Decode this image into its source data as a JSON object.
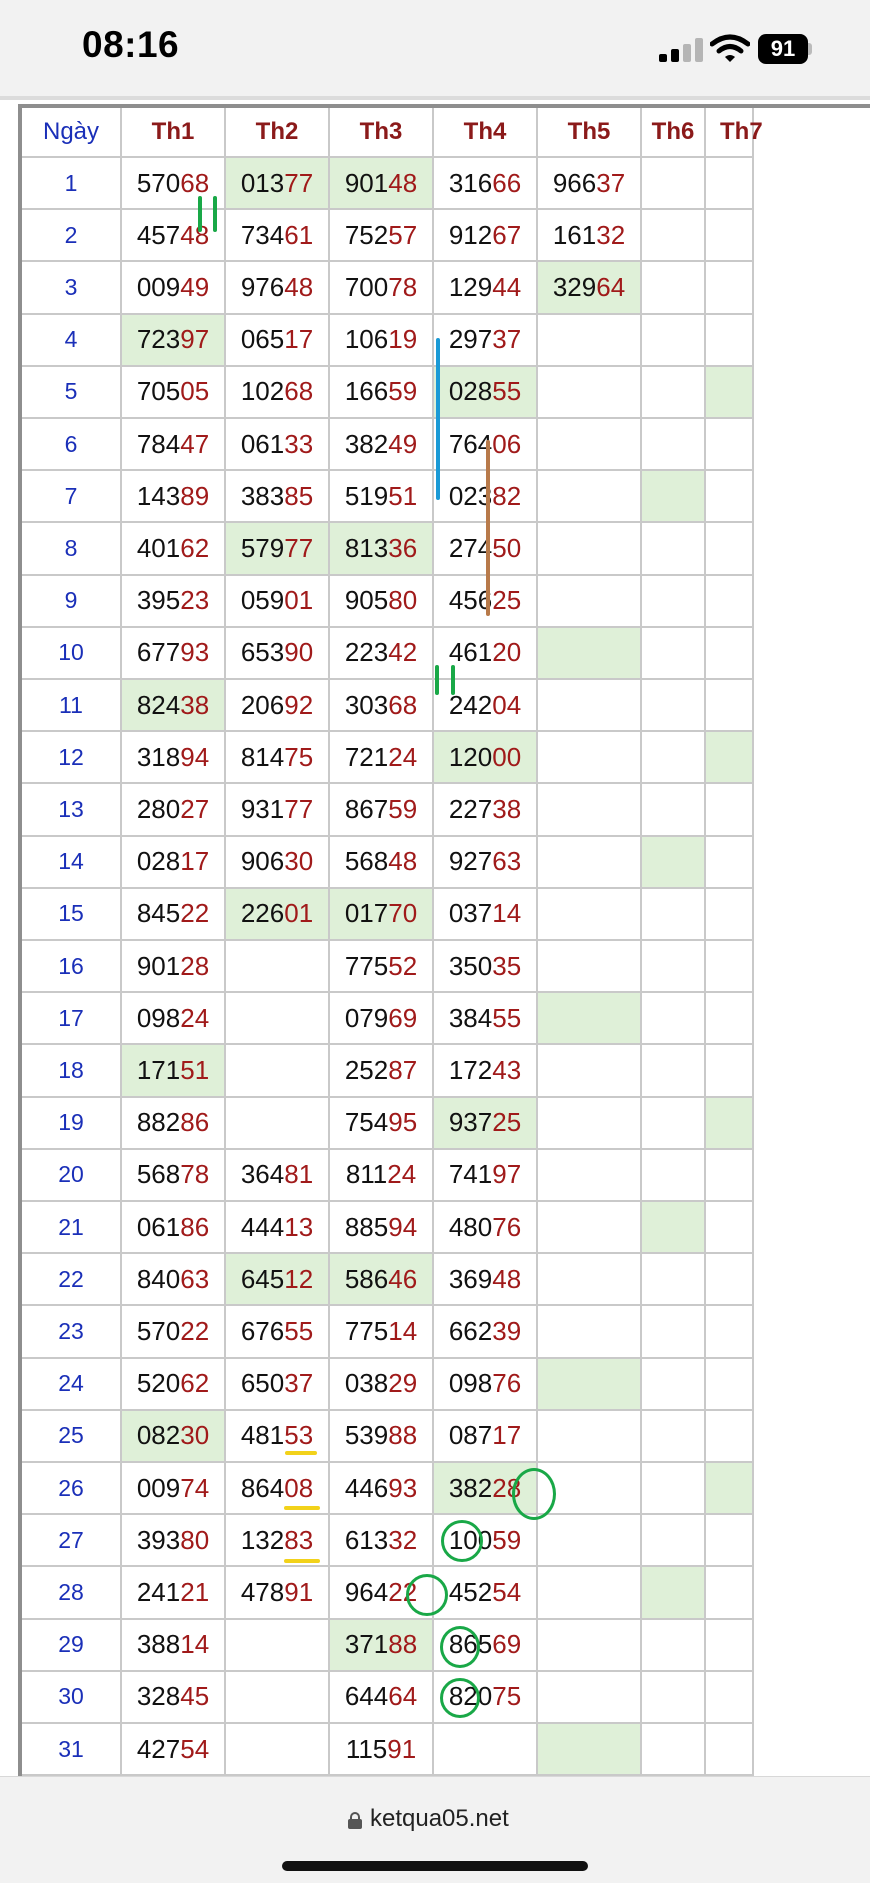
{
  "status": {
    "time": "08:16",
    "battery": "91"
  },
  "browser": {
    "url": "ketqua05.net"
  },
  "table": {
    "headers": [
      "Ngày",
      "Th1",
      "Th2",
      "Th3",
      "Th4",
      "Th5",
      "Th6",
      "Th7"
    ],
    "rows": [
      {
        "day": "1",
        "cells": [
          {
            "a": "570",
            "b": "68"
          },
          {
            "a": "013",
            "b": "77"
          },
          {
            "a": "901",
            "b": "48"
          },
          {
            "a": "316",
            "b": "66"
          },
          {
            "a": "966",
            "b": "37"
          },
          {
            "a": "",
            "b": ""
          },
          {
            "a": "",
            "b": ""
          }
        ]
      },
      {
        "day": "2",
        "cells": [
          {
            "a": "457",
            "b": "48"
          },
          {
            "a": "734",
            "b": "61"
          },
          {
            "a": "752",
            "b": "57"
          },
          {
            "a": "912",
            "b": "67"
          },
          {
            "a": "161",
            "b": "32"
          },
          {
            "a": "",
            "b": ""
          },
          {
            "a": "",
            "b": ""
          }
        ]
      },
      {
        "day": "3",
        "cells": [
          {
            "a": "009",
            "b": "49"
          },
          {
            "a": "976",
            "b": "48"
          },
          {
            "a": "700",
            "b": "78"
          },
          {
            "a": "129",
            "b": "44"
          },
          {
            "a": "329",
            "b": "64"
          },
          {
            "a": "",
            "b": ""
          },
          {
            "a": "",
            "b": ""
          }
        ]
      },
      {
        "day": "4",
        "cells": [
          {
            "a": "723",
            "b": "97"
          },
          {
            "a": "065",
            "b": "17"
          },
          {
            "a": "106",
            "b": "19"
          },
          {
            "a": "297",
            "b": "37"
          },
          {
            "a": "",
            "b": ""
          },
          {
            "a": "",
            "b": ""
          },
          {
            "a": "",
            "b": ""
          }
        ]
      },
      {
        "day": "5",
        "cells": [
          {
            "a": "705",
            "b": "05"
          },
          {
            "a": "102",
            "b": "68"
          },
          {
            "a": "166",
            "b": "59"
          },
          {
            "a": "028",
            "b": "55"
          },
          {
            "a": "",
            "b": ""
          },
          {
            "a": "",
            "b": ""
          },
          {
            "a": "",
            "b": ""
          }
        ]
      },
      {
        "day": "6",
        "cells": [
          {
            "a": "784",
            "b": "47"
          },
          {
            "a": "061",
            "b": "33"
          },
          {
            "a": "382",
            "b": "49"
          },
          {
            "a": "764",
            "b": "06"
          },
          {
            "a": "",
            "b": ""
          },
          {
            "a": "",
            "b": ""
          },
          {
            "a": "",
            "b": ""
          }
        ]
      },
      {
        "day": "7",
        "cells": [
          {
            "a": "143",
            "b": "89"
          },
          {
            "a": "383",
            "b": "85"
          },
          {
            "a": "519",
            "b": "51"
          },
          {
            "a": "023",
            "b": "82"
          },
          {
            "a": "",
            "b": ""
          },
          {
            "a": "",
            "b": ""
          },
          {
            "a": "",
            "b": ""
          }
        ]
      },
      {
        "day": "8",
        "cells": [
          {
            "a": "401",
            "b": "62"
          },
          {
            "a": "579",
            "b": "77"
          },
          {
            "a": "813",
            "b": "36"
          },
          {
            "a": "274",
            "b": "50"
          },
          {
            "a": "",
            "b": ""
          },
          {
            "a": "",
            "b": ""
          },
          {
            "a": "",
            "b": ""
          }
        ]
      },
      {
        "day": "9",
        "cells": [
          {
            "a": "395",
            "b": "23"
          },
          {
            "a": "059",
            "b": "01"
          },
          {
            "a": "905",
            "b": "80"
          },
          {
            "a": "456",
            "b": "25"
          },
          {
            "a": "",
            "b": ""
          },
          {
            "a": "",
            "b": ""
          },
          {
            "a": "",
            "b": ""
          }
        ]
      },
      {
        "day": "10",
        "cells": [
          {
            "a": "677",
            "b": "93"
          },
          {
            "a": "653",
            "b": "90"
          },
          {
            "a": "223",
            "b": "42"
          },
          {
            "a": "461",
            "b": "20"
          },
          {
            "a": "",
            "b": ""
          },
          {
            "a": "",
            "b": ""
          },
          {
            "a": "",
            "b": ""
          }
        ]
      },
      {
        "day": "11",
        "cells": [
          {
            "a": "824",
            "b": "38"
          },
          {
            "a": "206",
            "b": "92"
          },
          {
            "a": "303",
            "b": "68"
          },
          {
            "a": "242",
            "b": "04"
          },
          {
            "a": "",
            "b": ""
          },
          {
            "a": "",
            "b": ""
          },
          {
            "a": "",
            "b": ""
          }
        ]
      },
      {
        "day": "12",
        "cells": [
          {
            "a": "318",
            "b": "94"
          },
          {
            "a": "814",
            "b": "75"
          },
          {
            "a": "721",
            "b": "24"
          },
          {
            "a": "120",
            "b": "00"
          },
          {
            "a": "",
            "b": ""
          },
          {
            "a": "",
            "b": ""
          },
          {
            "a": "",
            "b": ""
          }
        ]
      },
      {
        "day": "13",
        "cells": [
          {
            "a": "280",
            "b": "27"
          },
          {
            "a": "931",
            "b": "77"
          },
          {
            "a": "867",
            "b": "59"
          },
          {
            "a": "227",
            "b": "38"
          },
          {
            "a": "",
            "b": ""
          },
          {
            "a": "",
            "b": ""
          },
          {
            "a": "",
            "b": ""
          }
        ]
      },
      {
        "day": "14",
        "cells": [
          {
            "a": "028",
            "b": "17"
          },
          {
            "a": "906",
            "b": "30"
          },
          {
            "a": "568",
            "b": "48"
          },
          {
            "a": "927",
            "b": "63"
          },
          {
            "a": "",
            "b": ""
          },
          {
            "a": "",
            "b": ""
          },
          {
            "a": "",
            "b": ""
          }
        ]
      },
      {
        "day": "15",
        "cells": [
          {
            "a": "845",
            "b": "22"
          },
          {
            "a": "226",
            "b": "01"
          },
          {
            "a": "017",
            "b": "70"
          },
          {
            "a": "037",
            "b": "14"
          },
          {
            "a": "",
            "b": ""
          },
          {
            "a": "",
            "b": ""
          },
          {
            "a": "",
            "b": ""
          }
        ]
      },
      {
        "day": "16",
        "cells": [
          {
            "a": "901",
            "b": "28"
          },
          {
            "a": "",
            "b": ""
          },
          {
            "a": "775",
            "b": "52"
          },
          {
            "a": "350",
            "b": "35"
          },
          {
            "a": "",
            "b": ""
          },
          {
            "a": "",
            "b": ""
          },
          {
            "a": "",
            "b": ""
          }
        ]
      },
      {
        "day": "17",
        "cells": [
          {
            "a": "098",
            "b": "24"
          },
          {
            "a": "",
            "b": ""
          },
          {
            "a": "079",
            "b": "69"
          },
          {
            "a": "384",
            "b": "55"
          },
          {
            "a": "",
            "b": ""
          },
          {
            "a": "",
            "b": ""
          },
          {
            "a": "",
            "b": ""
          }
        ]
      },
      {
        "day": "18",
        "cells": [
          {
            "a": "171",
            "b": "51"
          },
          {
            "a": "",
            "b": ""
          },
          {
            "a": "252",
            "b": "87"
          },
          {
            "a": "172",
            "b": "43"
          },
          {
            "a": "",
            "b": ""
          },
          {
            "a": "",
            "b": ""
          },
          {
            "a": "",
            "b": ""
          }
        ]
      },
      {
        "day": "19",
        "cells": [
          {
            "a": "882",
            "b": "86"
          },
          {
            "a": "",
            "b": ""
          },
          {
            "a": "754",
            "b": "95"
          },
          {
            "a": "937",
            "b": "25"
          },
          {
            "a": "",
            "b": ""
          },
          {
            "a": "",
            "b": ""
          },
          {
            "a": "",
            "b": ""
          }
        ]
      },
      {
        "day": "20",
        "cells": [
          {
            "a": "568",
            "b": "78"
          },
          {
            "a": "364",
            "b": "81"
          },
          {
            "a": "811",
            "b": "24"
          },
          {
            "a": "741",
            "b": "97"
          },
          {
            "a": "",
            "b": ""
          },
          {
            "a": "",
            "b": ""
          },
          {
            "a": "",
            "b": ""
          }
        ]
      },
      {
        "day": "21",
        "cells": [
          {
            "a": "061",
            "b": "86"
          },
          {
            "a": "444",
            "b": "13"
          },
          {
            "a": "885",
            "b": "94"
          },
          {
            "a": "480",
            "b": "76"
          },
          {
            "a": "",
            "b": ""
          },
          {
            "a": "",
            "b": ""
          },
          {
            "a": "",
            "b": ""
          }
        ]
      },
      {
        "day": "22",
        "cells": [
          {
            "a": "840",
            "b": "63"
          },
          {
            "a": "645",
            "b": "12"
          },
          {
            "a": "586",
            "b": "46"
          },
          {
            "a": "369",
            "b": "48"
          },
          {
            "a": "",
            "b": ""
          },
          {
            "a": "",
            "b": ""
          },
          {
            "a": "",
            "b": ""
          }
        ]
      },
      {
        "day": "23",
        "cells": [
          {
            "a": "570",
            "b": "22"
          },
          {
            "a": "676",
            "b": "55"
          },
          {
            "a": "775",
            "b": "14"
          },
          {
            "a": "662",
            "b": "39"
          },
          {
            "a": "",
            "b": ""
          },
          {
            "a": "",
            "b": ""
          },
          {
            "a": "",
            "b": ""
          }
        ]
      },
      {
        "day": "24",
        "cells": [
          {
            "a": "520",
            "b": "62"
          },
          {
            "a": "650",
            "b": "37"
          },
          {
            "a": "038",
            "b": "29"
          },
          {
            "a": "098",
            "b": "76"
          },
          {
            "a": "",
            "b": ""
          },
          {
            "a": "",
            "b": ""
          },
          {
            "a": "",
            "b": ""
          }
        ]
      },
      {
        "day": "25",
        "cells": [
          {
            "a": "082",
            "b": "30"
          },
          {
            "a": "481",
            "b": "53"
          },
          {
            "a": "539",
            "b": "88"
          },
          {
            "a": "087",
            "b": "17"
          },
          {
            "a": "",
            "b": ""
          },
          {
            "a": "",
            "b": ""
          },
          {
            "a": "",
            "b": ""
          }
        ]
      },
      {
        "day": "26",
        "cells": [
          {
            "a": "009",
            "b": "74"
          },
          {
            "a": "864",
            "b": "08"
          },
          {
            "a": "446",
            "b": "93"
          },
          {
            "a": "382",
            "b": "28"
          },
          {
            "a": "",
            "b": ""
          },
          {
            "a": "",
            "b": ""
          },
          {
            "a": "",
            "b": ""
          }
        ]
      },
      {
        "day": "27",
        "cells": [
          {
            "a": "393",
            "b": "80"
          },
          {
            "a": "132",
            "b": "83"
          },
          {
            "a": "613",
            "b": "32"
          },
          {
            "a": "100",
            "b": "59"
          },
          {
            "a": "",
            "b": ""
          },
          {
            "a": "",
            "b": ""
          },
          {
            "a": "",
            "b": ""
          }
        ]
      },
      {
        "day": "28",
        "cells": [
          {
            "a": "241",
            "b": "21"
          },
          {
            "a": "478",
            "b": "91"
          },
          {
            "a": "964",
            "b": "22"
          },
          {
            "a": "452",
            "b": "54"
          },
          {
            "a": "",
            "b": ""
          },
          {
            "a": "",
            "b": ""
          },
          {
            "a": "",
            "b": ""
          }
        ]
      },
      {
        "day": "29",
        "cells": [
          {
            "a": "388",
            "b": "14"
          },
          {
            "a": "",
            "b": ""
          },
          {
            "a": "371",
            "b": "88"
          },
          {
            "a": "865",
            "b": "69"
          },
          {
            "a": "",
            "b": ""
          },
          {
            "a": "",
            "b": ""
          },
          {
            "a": "",
            "b": ""
          }
        ]
      },
      {
        "day": "30",
        "cells": [
          {
            "a": "328",
            "b": "45"
          },
          {
            "a": "",
            "b": ""
          },
          {
            "a": "644",
            "b": "64"
          },
          {
            "a": "820",
            "b": "75"
          },
          {
            "a": "",
            "b": ""
          },
          {
            "a": "",
            "b": ""
          },
          {
            "a": "",
            "b": ""
          }
        ]
      },
      {
        "day": "31",
        "cells": [
          {
            "a": "427",
            "b": "54"
          },
          {
            "a": "",
            "b": ""
          },
          {
            "a": "115",
            "b": "91"
          },
          {
            "a": "",
            "b": ""
          },
          {
            "a": "",
            "b": ""
          },
          {
            "a": "",
            "b": ""
          },
          {
            "a": "",
            "b": ""
          }
        ]
      }
    ],
    "highlighted": [
      [
        0,
        1
      ],
      [
        0,
        2
      ],
      [
        2,
        4
      ],
      [
        3,
        0
      ],
      [
        4,
        3
      ],
      [
        4,
        6
      ],
      [
        6,
        5
      ],
      [
        7,
        1
      ],
      [
        7,
        2
      ],
      [
        9,
        4
      ],
      [
        10,
        0
      ],
      [
        11,
        3
      ],
      [
        11,
        6
      ],
      [
        13,
        5
      ],
      [
        14,
        1
      ],
      [
        14,
        2
      ],
      [
        16,
        4
      ],
      [
        17,
        0
      ],
      [
        18,
        3
      ],
      [
        18,
        6
      ],
      [
        20,
        5
      ],
      [
        21,
        1
      ],
      [
        21,
        2
      ],
      [
        23,
        4
      ],
      [
        24,
        0
      ],
      [
        25,
        3
      ],
      [
        25,
        6
      ],
      [
        27,
        5
      ],
      [
        28,
        2
      ],
      [
        30,
        4
      ]
    ]
  },
  "colors": {
    "day_blue": "#1a2fb8",
    "header_red": "#8b1a1a",
    "digit_red": "#a01a1a",
    "highlight": "#dff0d8",
    "annotation_green": "#19a847",
    "annotation_blue": "#1a9ad6",
    "annotation_brown": "#b87a4a",
    "annotation_yellow": "#f2d21a"
  },
  "icons": [
    "signal-icon",
    "wifi-icon",
    "battery-icon",
    "lock-icon"
  ]
}
